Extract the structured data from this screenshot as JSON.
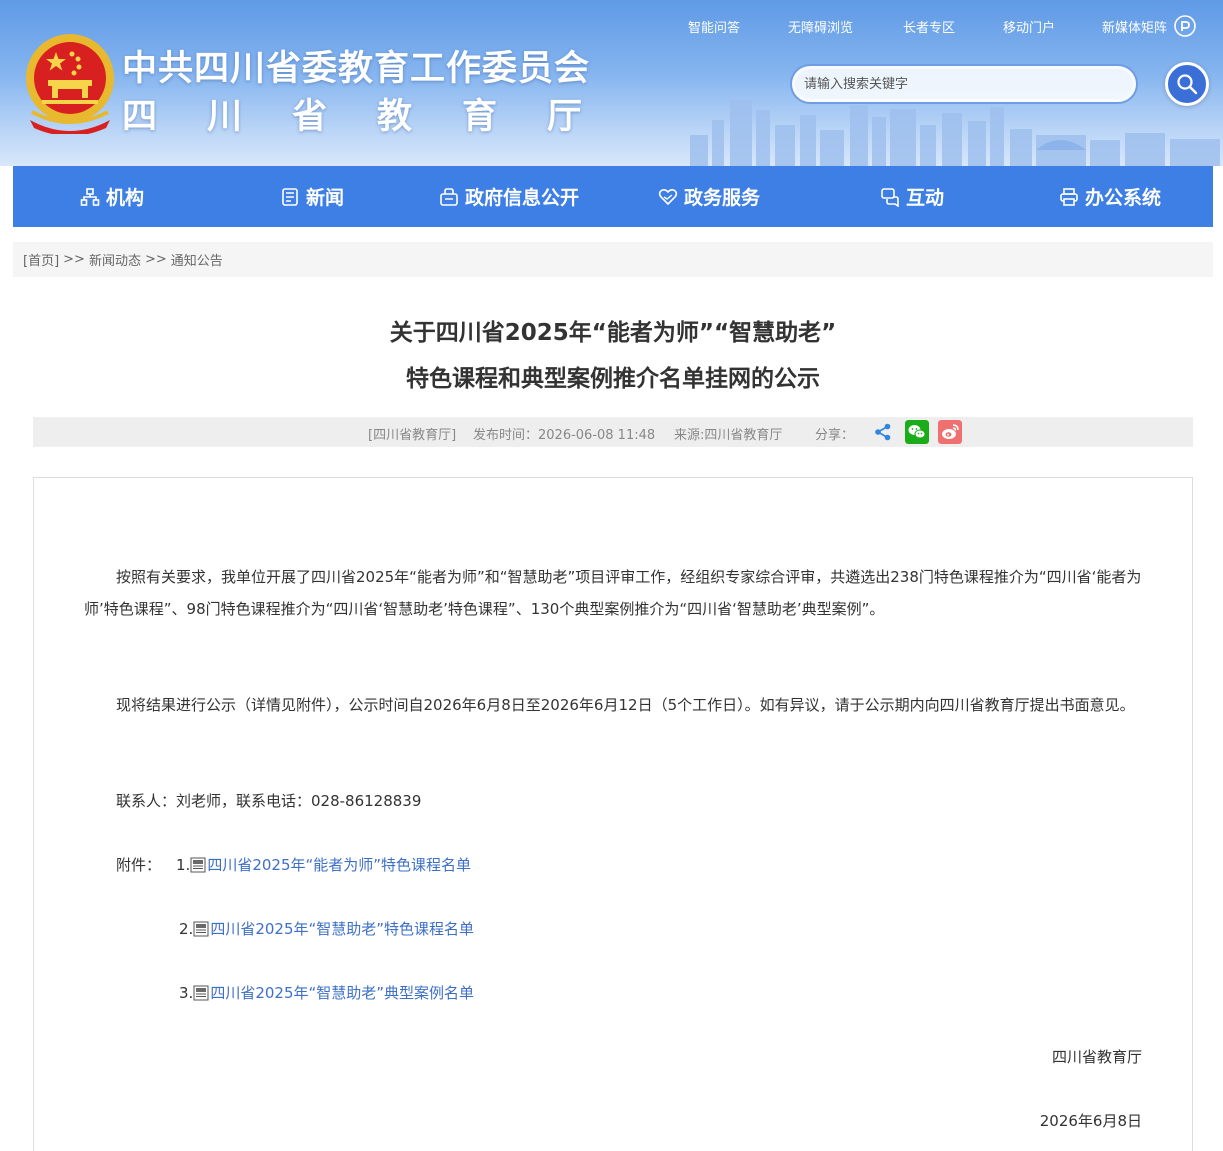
{
  "header": {
    "site_title": "中共四川省委教育工作委员会",
    "site_subtitle_chars": [
      "四",
      "川",
      "省",
      "教",
      "育",
      "厅"
    ],
    "top_links": [
      "智能问答",
      "无障碍浏览",
      "长者专区",
      "移动门户",
      "新媒体矩阵"
    ],
    "search_placeholder": "请输入搜索关键字"
  },
  "nav": {
    "items": [
      {
        "label": "机构",
        "icon": "org-chart-icon"
      },
      {
        "label": "新闻",
        "icon": "news-icon"
      },
      {
        "label": "政府信息公开",
        "icon": "info-public-icon"
      },
      {
        "label": "政务服务",
        "icon": "service-heart-icon"
      },
      {
        "label": "互动",
        "icon": "chat-icon"
      },
      {
        "label": "办公系统",
        "icon": "printer-icon"
      }
    ]
  },
  "breadcrumb": {
    "home": "[首页]",
    "sep": ">>",
    "level1": "新闻动态",
    "level2": "通知公告"
  },
  "article": {
    "title_line1": "关于四川省2025年“能者为师”“智慧助老”",
    "title_line2": "特色课程和典型案例推介名单挂网的公示",
    "meta_org": "[四川省教育厅]",
    "meta_time": "发布时间：2026-06-08 11:48",
    "meta_source": "来源:四川省教育厅",
    "meta_share": "分享：",
    "para1": "按照有关要求，我单位开展了四川省2025年“能者为师”和“智慧助老”项目评审工作，经组织专家综合评审，共遴选出238门特色课程推介为“四川省‘能者为师’特色课程”、98门特色课程推介为“四川省‘智慧助老’特色课程”、130个典型案例推介为“四川省‘智慧助老’典型案例”。",
    "para2": "现将结果进行公示（详情见附件），公示时间自2026年6月8日至2026年6月12日（5个工作日）。如有异议，请于公示期内向四川省教育厅提出书面意见。",
    "contact": "联系人：刘老师，联系电话：028-86128839",
    "attach_label": "附件：",
    "attachments": [
      {
        "num": "1.",
        "title": "四川省2025年“能者为师”特色课程名单"
      },
      {
        "num": "2.",
        "title": "四川省2025年“智慧助老”特色课程名单"
      },
      {
        "num": "3.",
        "title": "四川省2025年“智慧助老”典型案例名单"
      }
    ],
    "signature_org": "四川省教育厅",
    "signature_date": "2026年6月8日"
  },
  "colors": {
    "nav_bg": "#3e7fe6",
    "link": "#3e6fc7",
    "search_button": "#3a6fd8",
    "wechat_green": "#1aad19",
    "weibo_red": "#f07070"
  }
}
